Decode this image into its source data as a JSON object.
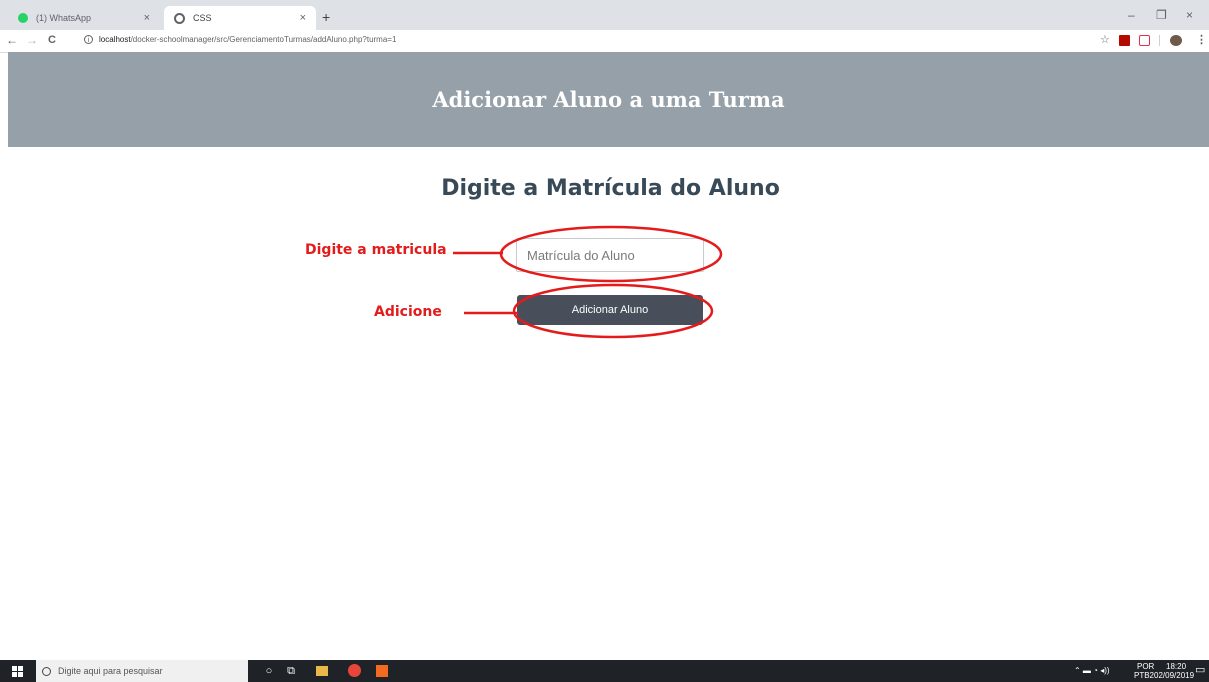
{
  "browser": {
    "tabs": [
      {
        "label": "(1) WhatsApp"
      },
      {
        "label": "CSS"
      }
    ],
    "new_tab": "+",
    "close_glyph": "×",
    "window_controls": {
      "minimize": "–",
      "restore": "❐",
      "close": "×"
    },
    "nav": {
      "back": "←",
      "forward": "→",
      "reload": "C"
    },
    "url": {
      "host": "localhost",
      "path": "/docker-schoolmanager/src/GerenciamentoTurmas/addAluno.php?turma=1",
      "info_glyph": "i"
    },
    "toolbar_icons": [
      "star-icon",
      "pdf-extension-icon",
      "pocket-extension-icon",
      "profile-avatar-icon",
      "menu-icon"
    ]
  },
  "page": {
    "header_title": "Adicionar Aluno a uma Turma",
    "subtitle": "Digite a Matrícula do Aluno",
    "input_placeholder": "Matrícula do Aluno",
    "button_label": "Adicionar Aluno"
  },
  "annotations": {
    "input_note": "Digite a matricula",
    "button_note": "Adicione",
    "color": "#e41b1b"
  },
  "taskbar": {
    "search_placeholder": "Digite aqui para pesquisar",
    "language_top": "POR",
    "language_bottom": "PTB2",
    "time": "18:20",
    "date": "02/09/2019"
  },
  "colors": {
    "header_bg": "#95a0a9",
    "subtitle": "#384957",
    "button_bg": "#484f5b"
  }
}
